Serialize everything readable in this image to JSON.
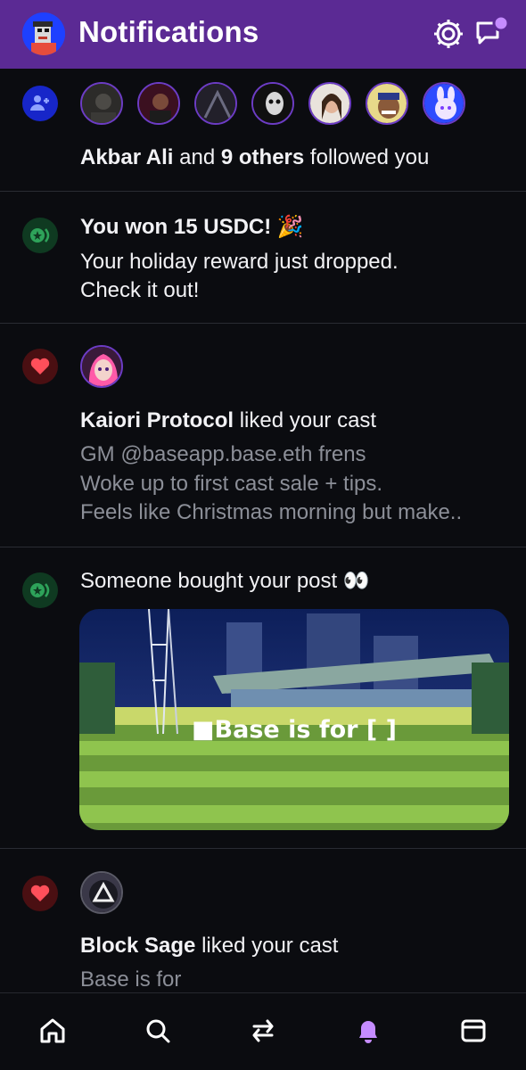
{
  "header": {
    "title": "Notifications"
  },
  "notifications": [
    {
      "type": "follow",
      "actor": "Akbar Ali",
      "middle": "and",
      "others": "9 others",
      "action": "followed you"
    },
    {
      "type": "reward",
      "title": "You won 15 USDC! 🎉",
      "body_line1": "Your holiday reward just dropped.",
      "body_line2": "Check it out!"
    },
    {
      "type": "like",
      "actor": "Kaiori Protocol",
      "action": "liked your cast",
      "preview_line1": "GM @baseapp.base.eth frens",
      "preview_line2": "Woke up to first cast sale + tips.",
      "preview_line3": "Feels like Christmas morning but make.."
    },
    {
      "type": "purchase",
      "title": "Someone bought your post 👀",
      "image_caption": "■Base is for [          ]"
    },
    {
      "type": "like",
      "actor": "Block Sage",
      "action": "liked your cast",
      "preview_line1": "Base is for"
    }
  ],
  "nav": [
    "home",
    "search",
    "swap",
    "notifications",
    "wallet"
  ],
  "colors": {
    "header_bg": "#5b2a94",
    "accent": "#c58cff",
    "background": "#0b0c10"
  }
}
